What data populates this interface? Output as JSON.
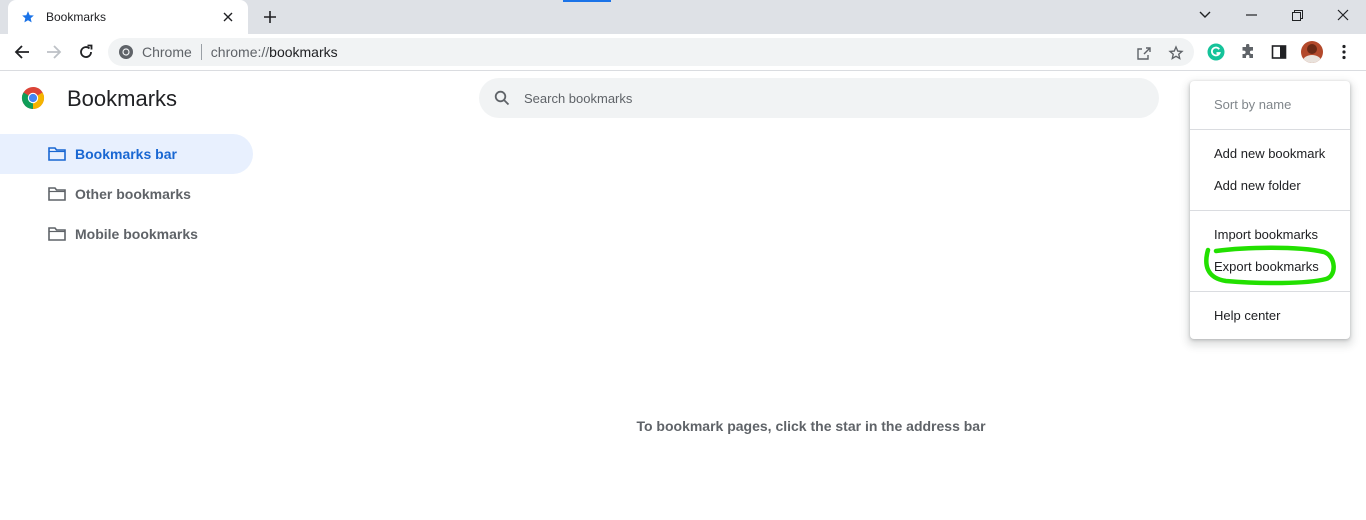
{
  "browser": {
    "tab": {
      "title": "Bookmarks",
      "favicon": "star-icon"
    },
    "omnibox": {
      "chip": "Chrome",
      "url_scheme": "chrome://",
      "url_host": "bookmarks"
    },
    "colors": {
      "accent": "#1a73e8",
      "tabstrip": "#dee1e6",
      "grammarly": "#15c39a"
    }
  },
  "page": {
    "title": "Bookmarks",
    "search": {
      "placeholder": "Search bookmarks",
      "value": ""
    },
    "sidebar": {
      "items": [
        {
          "label": "Bookmarks bar",
          "active": true,
          "icon": "folder-icon"
        },
        {
          "label": "Other bookmarks",
          "active": false,
          "icon": "folder-icon"
        },
        {
          "label": "Mobile bookmarks",
          "active": false,
          "icon": "folder-icon"
        }
      ]
    },
    "empty_message": "To bookmark pages, click the star in the address bar"
  },
  "menu": {
    "items": [
      {
        "label": "Sort by name",
        "disabled": true
      },
      {
        "label": "Add new bookmark",
        "disabled": false
      },
      {
        "label": "Add new folder",
        "disabled": false
      },
      {
        "label": "Import bookmarks",
        "disabled": false
      },
      {
        "label": "Export bookmarks",
        "disabled": false,
        "highlighted": true
      },
      {
        "label": "Help center",
        "disabled": false
      }
    ],
    "highlight_color": "#22e000"
  }
}
